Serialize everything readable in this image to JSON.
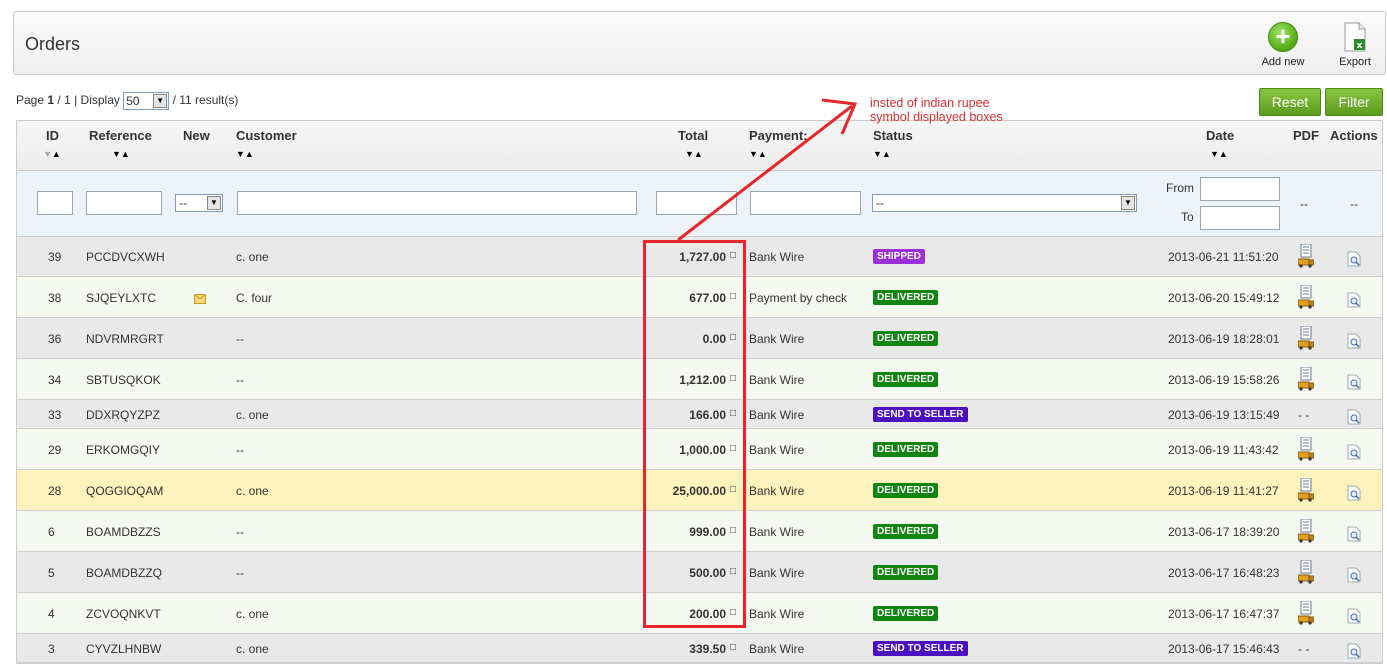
{
  "toolbar": {
    "title": "Orders",
    "add_label": "Add new",
    "export_label": "Export"
  },
  "pager": {
    "page_prefix": "Page",
    "page_current": "1",
    "page_sep": "/ 1 | Display",
    "display_value": "50",
    "results": "/ 11 result(s)"
  },
  "buttons": {
    "reset": "Reset",
    "filter": "Filter"
  },
  "columns": {
    "id": "ID",
    "reference": "Reference",
    "new": "New",
    "customer": "Customer",
    "total": "Total",
    "payment": "Payment:",
    "status": "Status",
    "date": "Date",
    "pdf": "PDF",
    "actions": "Actions"
  },
  "filters": {
    "new_select": "--",
    "status_select": "--",
    "from_label": "From",
    "to_label": "To",
    "pdf_placeholder": "--",
    "actions_placeholder": "--"
  },
  "currency_glyph": "□",
  "rows": [
    {
      "id": "39",
      "ref": "PCCDVCXWH",
      "new": false,
      "customer": "c. one",
      "total": "1,727.00",
      "payment": "Bank Wire",
      "status": "SHIPPED",
      "status_color": "#9b30d9",
      "date": "2013-06-21 11:51:20",
      "pdf": true
    },
    {
      "id": "38",
      "ref": "SJQEYLXTC",
      "new": true,
      "customer": "C. four",
      "total": "677.00",
      "payment": "Payment by check",
      "status": "DELIVERED",
      "status_color": "#108510",
      "date": "2013-06-20 15:49:12",
      "pdf": true
    },
    {
      "id": "36",
      "ref": "NDVRMRGRT",
      "new": false,
      "customer": "--",
      "total": "0.00",
      "payment": "Bank Wire",
      "status": "DELIVERED",
      "status_color": "#108510",
      "date": "2013-06-19 18:28:01",
      "pdf": true
    },
    {
      "id": "34",
      "ref": "SBTUSQKOK",
      "new": false,
      "customer": "--",
      "total": "1,212.00",
      "payment": "Bank Wire",
      "status": "DELIVERED",
      "status_color": "#108510",
      "date": "2013-06-19 15:58:26",
      "pdf": true
    },
    {
      "id": "33",
      "ref": "DDXRQYZPZ",
      "new": false,
      "customer": "c. one",
      "total": "166.00",
      "payment": "Bank Wire",
      "status": "SEND TO SELLER",
      "status_color": "#4b0fbf",
      "date": "2013-06-19 13:15:49",
      "pdf": false,
      "pdf_text": "- -"
    },
    {
      "id": "29",
      "ref": "ERKOMGQIY",
      "new": false,
      "customer": "--",
      "total": "1,000.00",
      "payment": "Bank Wire",
      "status": "DELIVERED",
      "status_color": "#108510",
      "date": "2013-06-19 11:43:42",
      "pdf": true
    },
    {
      "id": "28",
      "ref": "QOGGIOQAM",
      "new": false,
      "customer": "c. one",
      "total": "25,000.00",
      "payment": "Bank Wire",
      "status": "DELIVERED",
      "status_color": "#108510",
      "date": "2013-06-19 11:41:27",
      "pdf": true
    },
    {
      "id": "6",
      "ref": "BOAMDBZZS",
      "new": false,
      "customer": "--",
      "total": "999.00",
      "payment": "Bank Wire",
      "status": "DELIVERED",
      "status_color": "#108510",
      "date": "2013-06-17 18:39:20",
      "pdf": true
    },
    {
      "id": "5",
      "ref": "BOAMDBZZQ",
      "new": false,
      "customer": "--",
      "total": "500.00",
      "payment": "Bank Wire",
      "status": "DELIVERED",
      "status_color": "#108510",
      "date": "2013-06-17 16:48:23",
      "pdf": true
    },
    {
      "id": "4",
      "ref": "ZCVOQNKVT",
      "new": false,
      "customer": "c. one",
      "total": "200.00",
      "payment": "Bank Wire",
      "status": "DELIVERED",
      "status_color": "#108510",
      "date": "2013-06-17 16:47:37",
      "pdf": true
    },
    {
      "id": "3",
      "ref": "CYVZLHNBW",
      "new": false,
      "customer": "c. one",
      "total": "339.50",
      "payment": "Bank Wire",
      "status": "SEND TO SELLER",
      "status_color": "#4b0fbf",
      "date": "2013-06-17 15:46:43",
      "pdf": false,
      "pdf_text": "- -"
    }
  ],
  "annotation": {
    "text": "insted of indian rupee symbol displayed boxes",
    "color": "#e03030"
  }
}
